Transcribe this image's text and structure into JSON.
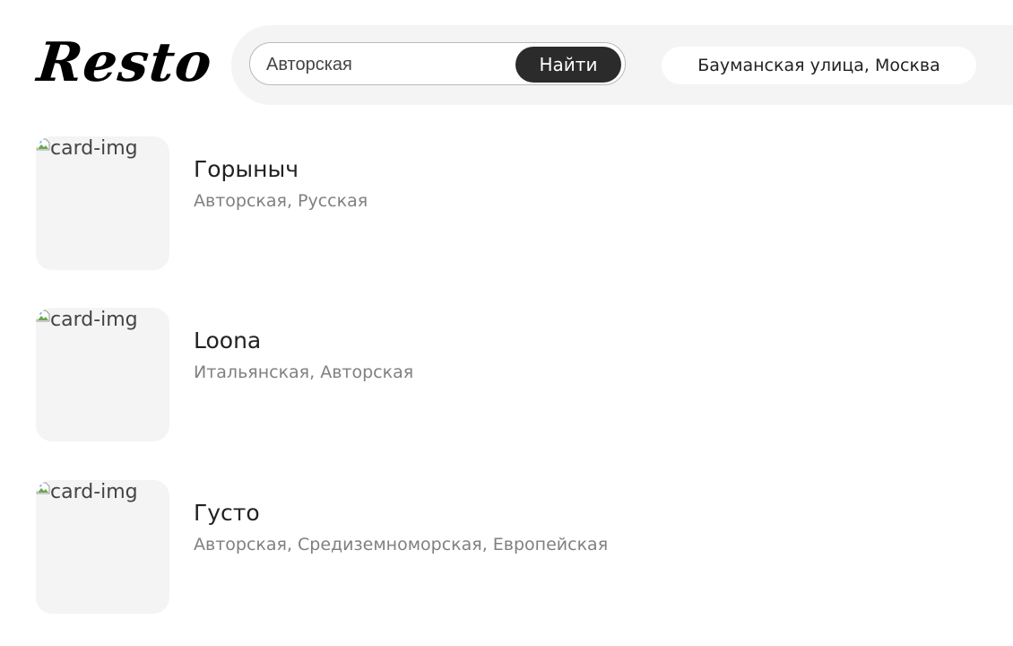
{
  "header": {
    "logo": "Resto",
    "search": {
      "value": "Авторская",
      "button_label": "Найти"
    },
    "address": "Бауманская улица, Москва"
  },
  "restaurants": [
    {
      "image_alt": "card-img",
      "name": "Горыныч",
      "cuisines": "Авторская, Русская"
    },
    {
      "image_alt": "card-img",
      "name": "Loona",
      "cuisines": "Итальянская, Авторская"
    },
    {
      "image_alt": "card-img",
      "name": "Густо",
      "cuisines": "Авторская, Средиземноморская, Европейская"
    }
  ]
}
